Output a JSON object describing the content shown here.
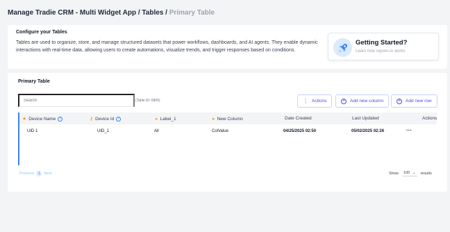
{
  "breadcrumb": {
    "path": "Manage Tradie CRM - Multi Widget App / Tables /",
    "current": "Primary Table"
  },
  "config": {
    "title": "Configure your Tables",
    "description": "Tables are used to organize, store, and manage structured datasets that power workflows, dashboards, and AI agents. They enable dynamic interactions with real-time data, allowing users to create automations, visualize trends, and trigger responses based on conditions."
  },
  "getting_started": {
    "title": "Getting Started?",
    "subtitle": "Learn how rayven.io works",
    "icon": "rocket-icon"
  },
  "table": {
    "heading": "Primary Table",
    "search_placeholder": "Search",
    "table_id": "(Table ID: 6805)",
    "actions_label": "Actions",
    "add_column_label": "Add new column",
    "add_row_label": "Add new row",
    "columns": [
      "Device Name",
      "Device Id",
      "Label_1",
      "New Column",
      "Date Created",
      "Last Updated",
      "Actions"
    ],
    "rows": [
      {
        "device_name": "UID 1",
        "device_id": "UID_1",
        "label_1": "All",
        "new_column": "ColValue",
        "date_created": "04/25/2025 02:50",
        "last_updated": "05/02/2025 02:26",
        "actions": "···"
      }
    ],
    "pagination": {
      "previous": "Previous",
      "page": "1",
      "next": "Next",
      "show_label": "Show",
      "page_size": "100",
      "results_label": "results"
    }
  },
  "colors": {
    "accent": "#4f46e5",
    "key": "#f59e0b",
    "row_marker": "#3b82f6"
  }
}
